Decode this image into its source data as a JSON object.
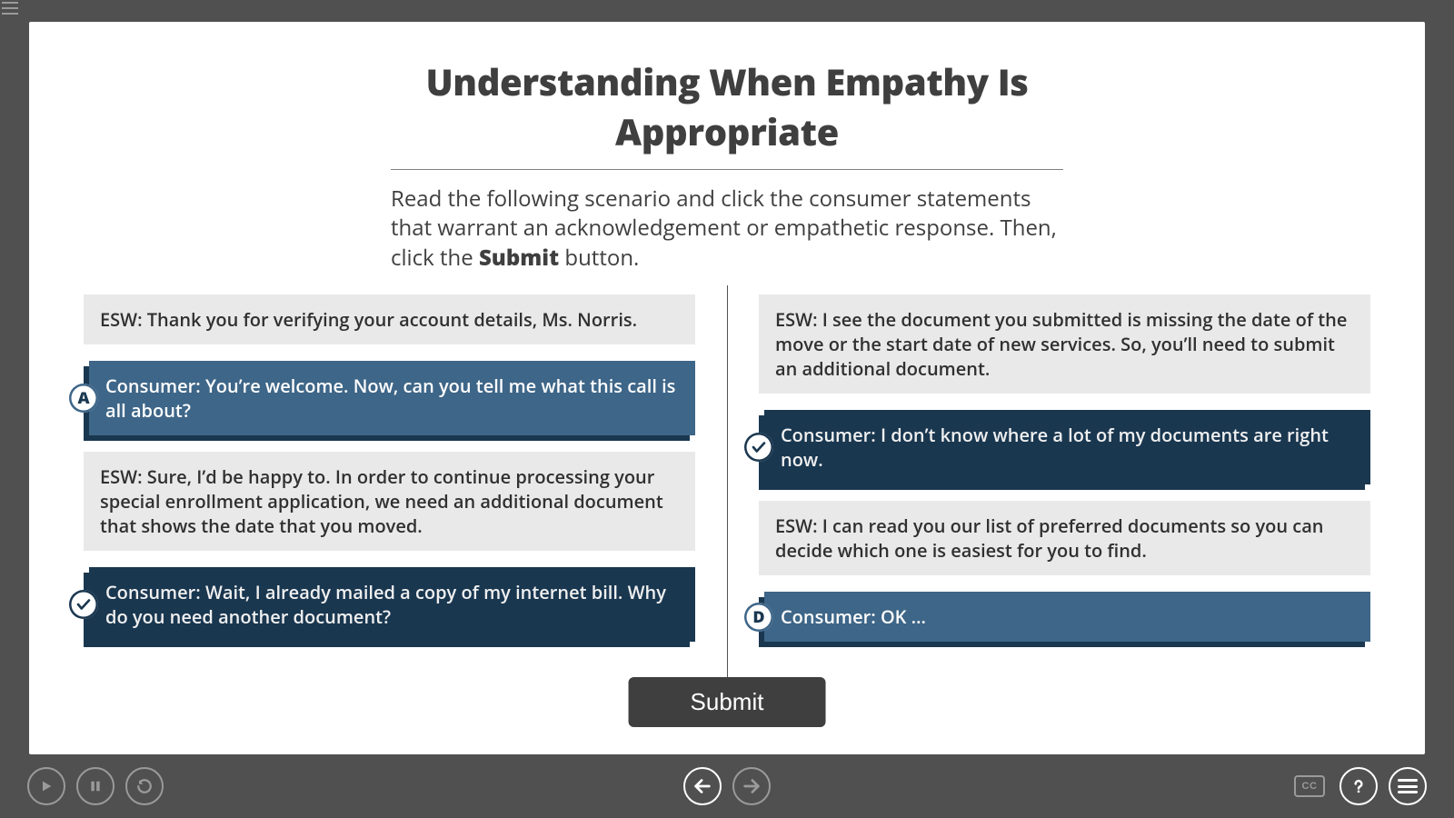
{
  "title": "Understanding When Empathy Is Appropriate",
  "instruction_pre": "Read the following scenario and click the consumer statements that warrant an acknowledgement or empathetic response. Then, click the ",
  "instruction_bold": "Submit",
  "instruction_post": " button.",
  "left": {
    "m0": "ESW: Thank you for verifying your account details, Ms. Norris.",
    "m1": {
      "badge": "A",
      "text": "Consumer: You’re welcome. Now, can you tell me what this call is all about?"
    },
    "m2": "ESW: Sure, I’d be happy to. In order to continue processing your special enrollment application, we need an additional document that shows the date that you moved.",
    "m3": {
      "badge": "check",
      "text": "Consumer: Wait, I already mailed a copy of my internet bill. Why do you need another document?"
    }
  },
  "right": {
    "m0": "ESW: I see the document you submitted is missing the date of the move or the start date of new services. So, you’ll need to submit an additional document.",
    "m1": {
      "badge": "check",
      "text": "Consumer: I don’t know where a lot of my documents are right now."
    },
    "m2": "ESW: I can read you our list of preferred documents so you can decide which one is easiest for you to find.",
    "m3": {
      "badge": "D",
      "text": "Consumer: OK …"
    }
  },
  "submit_label": "Submit",
  "footer": {
    "play": "play-icon",
    "pause": "pause-icon",
    "restart": "restart-icon",
    "prev": "prev-icon",
    "next": "next-icon",
    "cc": "CC",
    "help": "help-icon",
    "menu": "menu-icon"
  },
  "colors": {
    "chrome": "#505050",
    "consumer": "#3e6688",
    "consumer_selected": "#1a3750",
    "esw_bg": "#e9e9e9",
    "text": "#3f3f3f"
  }
}
